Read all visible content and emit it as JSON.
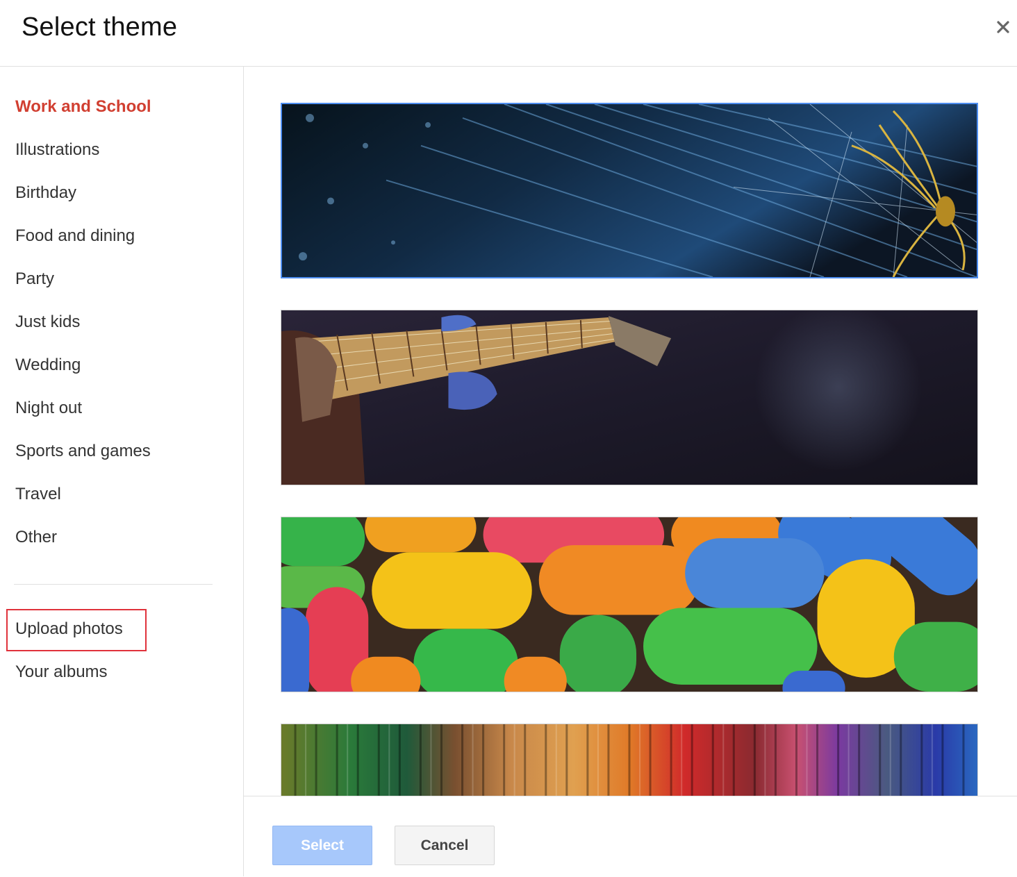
{
  "dialog": {
    "title": "Select theme"
  },
  "icons": {
    "close": "close-icon"
  },
  "sidebar": {
    "categories": [
      {
        "label": "Work and School",
        "active": true
      },
      {
        "label": "Illustrations"
      },
      {
        "label": "Birthday"
      },
      {
        "label": "Food and dining"
      },
      {
        "label": "Party"
      },
      {
        "label": "Just kids"
      },
      {
        "label": "Wedding"
      },
      {
        "label": "Night out"
      },
      {
        "label": "Sports and games"
      },
      {
        "label": "Travel"
      },
      {
        "label": "Other"
      }
    ],
    "upload_label": "Upload photos",
    "albums_label": "Your albums"
  },
  "themes": [
    {
      "name": "spider-web-theme",
      "selected": true
    },
    {
      "name": "guitar-theme"
    },
    {
      "name": "candy-theme"
    },
    {
      "name": "yarn-theme"
    }
  ],
  "footer": {
    "select_label": "Select",
    "cancel_label": "Cancel"
  },
  "colors": {
    "active_category": "#d13f31",
    "selected_border": "#4d8df0",
    "select_button": "#a7c8fb",
    "highlight_box": "#e0323b"
  }
}
